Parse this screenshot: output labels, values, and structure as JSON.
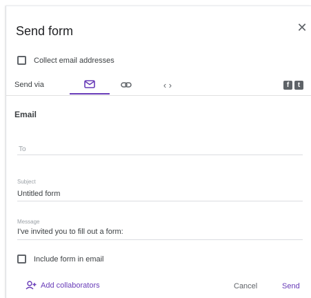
{
  "dialog": {
    "title": "Send form",
    "close_icon": "close-icon"
  },
  "collect_email": {
    "label": "Collect email addresses",
    "checked": false
  },
  "send_via": {
    "label": "Send via",
    "tabs": [
      {
        "name": "email",
        "icon": "mail-icon",
        "selected": true
      },
      {
        "name": "link",
        "icon": "link-icon",
        "selected": false
      },
      {
        "name": "embed",
        "icon": "code-icon",
        "glyph": "‹ ›",
        "selected": false
      }
    ],
    "social": [
      {
        "name": "facebook",
        "icon": "facebook-icon",
        "glyph": "f"
      },
      {
        "name": "twitter",
        "icon": "twitter-icon",
        "glyph": "t"
      }
    ]
  },
  "email": {
    "heading": "Email",
    "to": {
      "placeholder": "To"
    },
    "subject": {
      "label": "Subject",
      "value": "Untitled form"
    },
    "message": {
      "label": "Message",
      "value": "I've invited you to fill out a form:"
    },
    "include_form": {
      "label": "Include form in email",
      "checked": false
    }
  },
  "footer": {
    "add_collaborators": "Add collaborators",
    "cancel": "Cancel",
    "send": "Send"
  },
  "colors": {
    "accent": "#673ab7",
    "icon_gray": "#5f6368",
    "text": "#202124",
    "divider": "#dadce0"
  }
}
